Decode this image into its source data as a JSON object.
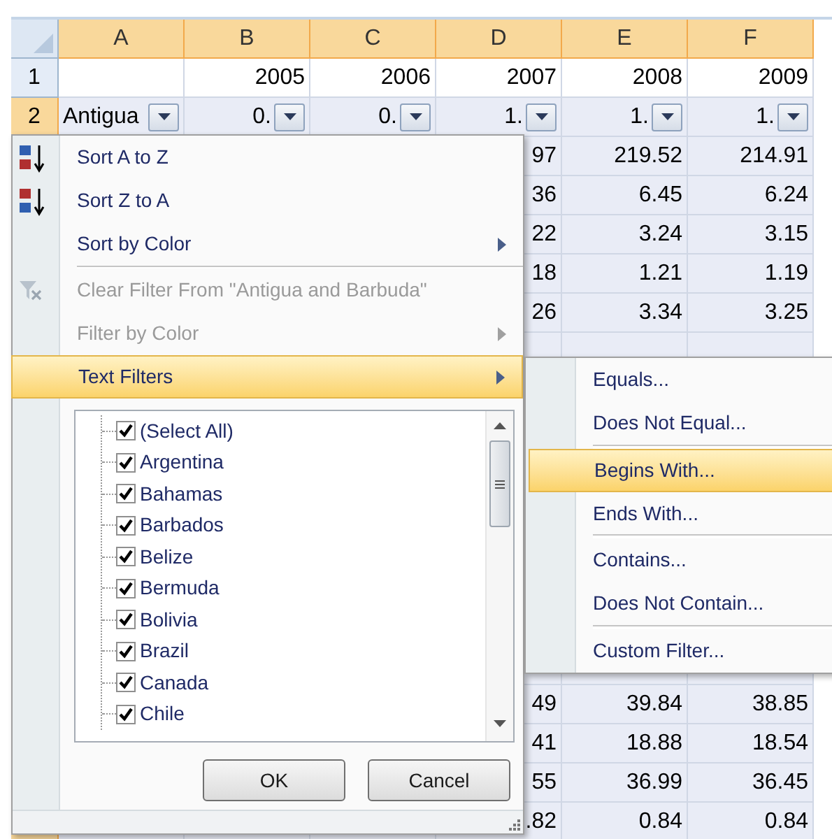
{
  "columns": [
    {
      "label": "A",
      "selected": true
    },
    {
      "label": "B",
      "selected": true
    },
    {
      "label": "C",
      "selected": true
    },
    {
      "label": "D",
      "selected": true
    },
    {
      "label": "E",
      "selected": true
    },
    {
      "label": "F",
      "selected": true
    }
  ],
  "rows": [
    {
      "number": "1",
      "selected": false,
      "values": [
        "2005",
        "2006",
        "2007",
        "2008",
        "2009"
      ]
    },
    {
      "number": "2",
      "selected": true,
      "filter_buttons": true,
      "values": [
        "Antigua",
        "0.",
        "0.",
        "1.",
        "1.",
        "1."
      ]
    },
    {
      "selected": true,
      "values": [
        "97",
        "219.52",
        "214.91"
      ]
    },
    {
      "selected": true,
      "values": [
        "36",
        "6.45",
        "6.24"
      ]
    },
    {
      "selected": true,
      "values": [
        "22",
        "3.24",
        "3.15"
      ]
    },
    {
      "selected": true,
      "values": [
        "18",
        "1.21",
        "1.19"
      ]
    },
    {
      "selected": true,
      "values": [
        "26",
        "3.34",
        "3.25"
      ]
    }
  ],
  "lower_rows": [
    {
      "selected": true,
      "values": [
        "49",
        "39.84",
        "38.85"
      ]
    },
    {
      "selected": true,
      "values": [
        "41",
        "18.88",
        "18.54"
      ]
    },
    {
      "selected": true,
      "values": [
        "55",
        "36.99",
        "36.45"
      ]
    },
    {
      "selected": true,
      "values": [
        ".82",
        "0.84",
        "0.84"
      ]
    }
  ],
  "filter_menu": {
    "items": [
      {
        "kind": "item",
        "label": "Sort A to Z",
        "disabled": false,
        "highlighted": false,
        "submenu": false
      },
      {
        "kind": "item",
        "label": "Sort Z to A",
        "disabled": false,
        "highlighted": false,
        "submenu": false
      },
      {
        "kind": "item",
        "label": "Sort by Color",
        "disabled": false,
        "highlighted": false,
        "submenu": true
      },
      {
        "kind": "separator"
      },
      {
        "kind": "item",
        "label": "Clear Filter From \"Antigua and Barbuda\"",
        "disabled": true,
        "highlighted": false,
        "submenu": false
      },
      {
        "kind": "item",
        "label": "Filter by Color",
        "disabled": true,
        "highlighted": false,
        "submenu": true
      },
      {
        "kind": "item",
        "label": "Text Filters",
        "disabled": false,
        "highlighted": true,
        "submenu": true
      }
    ],
    "values_list": [
      {
        "label": "(Select All)",
        "checked": true
      },
      {
        "label": "Argentina",
        "checked": true
      },
      {
        "label": "Bahamas",
        "checked": true
      },
      {
        "label": "Barbados",
        "checked": true
      },
      {
        "label": "Belize",
        "checked": true
      },
      {
        "label": "Bermuda",
        "checked": true
      },
      {
        "label": "Bolivia",
        "checked": true
      },
      {
        "label": "Brazil",
        "checked": true
      },
      {
        "label": "Canada",
        "checked": true
      },
      {
        "label": "Chile",
        "checked": true
      }
    ],
    "buttons": [
      "OK",
      "Cancel"
    ]
  },
  "text_filters_menu": {
    "items": [
      {
        "kind": "item",
        "label": "Equals...",
        "highlighted": false
      },
      {
        "kind": "item",
        "label": "Does Not Equal...",
        "highlighted": false
      },
      {
        "kind": "separator"
      },
      {
        "kind": "item",
        "label": "Begins With...",
        "highlighted": true
      },
      {
        "kind": "item",
        "label": "Ends With...",
        "highlighted": false
      },
      {
        "kind": "separator"
      },
      {
        "kind": "item",
        "label": "Contains...",
        "highlighted": false
      },
      {
        "kind": "item",
        "label": "Does Not Contain...",
        "highlighted": false
      },
      {
        "kind": "separator"
      },
      {
        "kind": "item",
        "label": "Custom Filter...",
        "highlighted": false
      }
    ]
  }
}
